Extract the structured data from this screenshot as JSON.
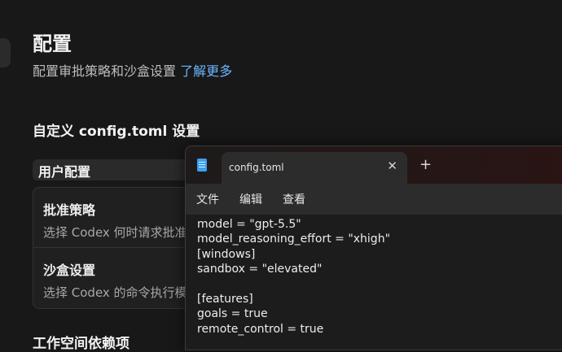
{
  "header": {
    "title": "配置",
    "subtitle": "配置审批策略和沙盒设置",
    "learn_more": "了解更多"
  },
  "section_title": "自定义 config.toml 设置",
  "user_config_tab": "用户配置",
  "settings": [
    {
      "title": "批准策略",
      "desc": "选择 Codex 何时请求批准"
    },
    {
      "title": "沙盒设置",
      "desc": "选择 Codex 的命令执行模式"
    }
  ],
  "next_section": "工作空间依赖项",
  "notepad": {
    "tab_label": "config.toml",
    "new_tab_symbol": "+",
    "close_symbol": "✕",
    "menu": [
      "文件",
      "编辑",
      "查看"
    ],
    "content": "model = \"gpt-5.5\"\nmodel_reasoning_effort = \"xhigh\"\n[windows]\nsandbox = \"elevated\"\n\n[features]\ngoals = true\nremote_control = true"
  }
}
